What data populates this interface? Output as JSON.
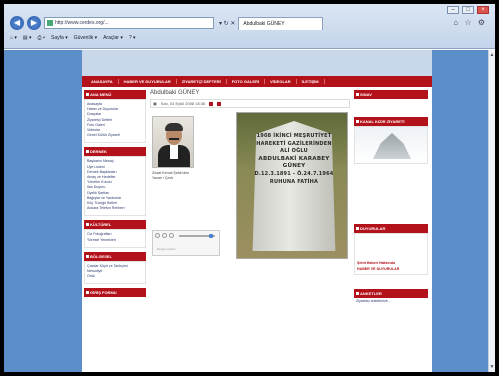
{
  "browser": {
    "address": "http://www.cerdes.org/...",
    "tab_title": "Abdulbaki GÜNEY",
    "commands": [
      "Sayfa ▾",
      "Güvenlik ▾",
      "Araçlar ▾"
    ]
  },
  "menu": [
    "ANASAYFA",
    "HABER VE DUYURULAR",
    "ZİYARETÇİ DEFTERİ",
    "FOTO GALERİ",
    "VİDEOLAR",
    "İLETİŞİM"
  ],
  "left": {
    "ana_menu": {
      "title": "ANA MENÜ",
      "items": [
        "Anasayfa",
        "Haber ve Duyurular",
        "Dosyalar",
        "Ziyaretçi Defteri",
        "Foto Galeri",
        "Videolar",
        "Genel Kültür Ziyareti"
      ]
    },
    "dernek": {
      "title": "DERNEK",
      "items": [
        "Başkanın Mesajı",
        "Üye Listesi",
        "Dernek Başkanları",
        "Amaç ve Hedefler",
        "Yönetim Kurulu",
        "İlan Duyuru",
        "Üyelik Şartları",
        "Bağışlar ve Yardımlar",
        "Köy Tüzüğü Belleri",
        "Ankara Telefon Rehberi"
      ]
    },
    "kulturel": {
      "title": "KÜLTÜREL",
      "items": [
        "Ciz Fotoğrafları",
        "Yöresel Yemekleri"
      ]
    },
    "bolgesel": {
      "title": "BÖLGESEL",
      "items": [
        "Çavdar Köyü ve Tarihçesi",
        "Mesudiye",
        "Ordu"
      ]
    },
    "giris": {
      "title": "GİRİŞ FORMU"
    }
  },
  "center": {
    "name": "Abdulbaki GÜNEY",
    "date": "Salı, 03 Eylül 2008 18:36",
    "caption_line1": "Ziraat Kemal Şahin'den",
    "caption_line2": "Yazan / Çevir",
    "player_status": "Medya oynatıcı",
    "inscription": [
      "1908 İKİNCİ MEŞRUTİYET",
      "HAREKETİ GAZİLERİNDEN",
      "ALİ OĞLU",
      "ABDULBAKİ KARABEY",
      "GÜNEY",
      "D.12.3.1891 - Ö.24.7.1964",
      "RUHUNA FATİHA"
    ]
  },
  "right": {
    "sinav_title": "SINAV",
    "kumru_title": "KANAL KIZIR ZİYARETİ",
    "duyurular_title": "DUYURULAR",
    "duyurular_links": [
      "Şehit Haberi Hakkında",
      "HABER VE DUYURULAR"
    ],
    "anketler_title": "ANKETLER",
    "anketler_text": "Ziyaretçi anketimize..."
  }
}
